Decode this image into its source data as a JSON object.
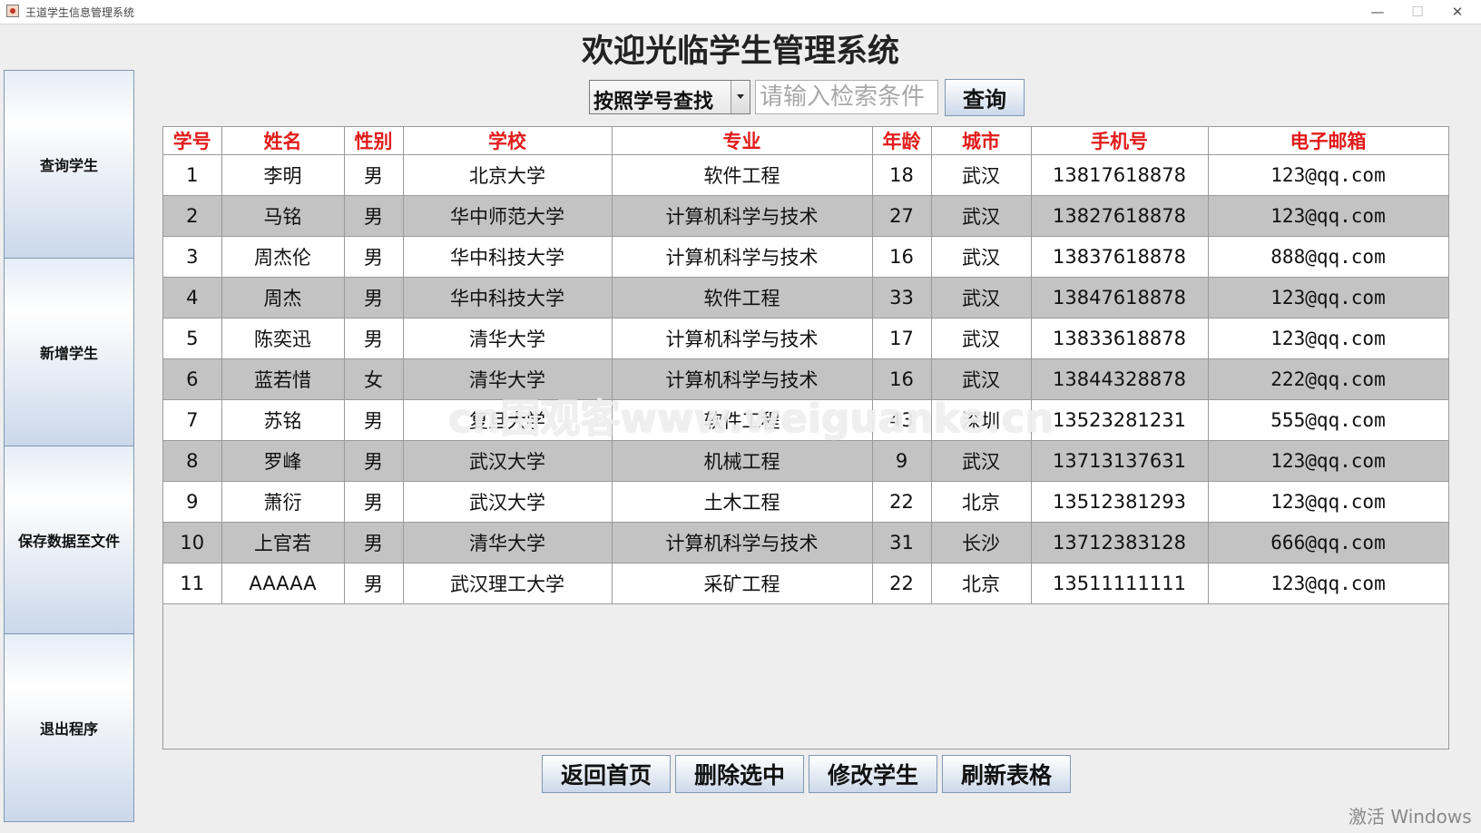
{
  "window": {
    "title": "王道学生信息管理系统",
    "minimize": "—",
    "maximize": "☐",
    "close": "✕"
  },
  "sidebar": {
    "items": [
      {
        "label": "查询学生"
      },
      {
        "label": "新增学生"
      },
      {
        "label": "保存数据至文件"
      },
      {
        "label": "退出程序"
      }
    ]
  },
  "main": {
    "title": "欢迎光临学生管理系统"
  },
  "search": {
    "mode": "按照学号查找",
    "placeholder": "请输入检索条件",
    "button": "查询"
  },
  "table": {
    "headers": [
      "学号",
      "姓名",
      "性别",
      "学校",
      "专业",
      "年龄",
      "城市",
      "手机号",
      "电子邮箱"
    ],
    "rows": [
      [
        "1",
        "李明",
        "男",
        "北京大学",
        "软件工程",
        "18",
        "武汉",
        "13817618878",
        "123@qq.com"
      ],
      [
        "2",
        "马铭",
        "男",
        "华中师范大学",
        "计算机科学与技术",
        "27",
        "武汉",
        "13827618878",
        "123@qq.com"
      ],
      [
        "3",
        "周杰伦",
        "男",
        "华中科技大学",
        "计算机科学与技术",
        "16",
        "武汉",
        "13837618878",
        "888@qq.com"
      ],
      [
        "4",
        "周杰",
        "男",
        "华中科技大学",
        "软件工程",
        "33",
        "武汉",
        "13847618878",
        "123@qq.com"
      ],
      [
        "5",
        "陈奕迅",
        "男",
        "清华大学",
        "计算机科学与技术",
        "17",
        "武汉",
        "13833618878",
        "123@qq.com"
      ],
      [
        "6",
        "蓝若惜",
        "女",
        "清华大学",
        "计算机科学与技术",
        "16",
        "武汉",
        "13844328878",
        "222@qq.com"
      ],
      [
        "7",
        "苏铭",
        "男",
        "复旦大学",
        "软件工程",
        "43",
        "深圳",
        "13523281231",
        "555@qq.com"
      ],
      [
        "8",
        "罗峰",
        "男",
        "武汉大学",
        "机械工程",
        "9",
        "武汉",
        "13713137631",
        "123@qq.com"
      ],
      [
        "9",
        "萧衍",
        "男",
        "武汉大学",
        "土木工程",
        "22",
        "北京",
        "13512381293",
        "123@qq.com"
      ],
      [
        "10",
        "上官若",
        "男",
        "清华大学",
        "计算机科学与技术",
        "31",
        "长沙",
        "13712383128",
        "666@qq.com"
      ],
      [
        "11",
        "AAAAA",
        "男",
        "武汉理工大学",
        "采矿工程",
        "22",
        "北京",
        "13511111111",
        "123@qq.com"
      ]
    ]
  },
  "actions": {
    "home": "返回首页",
    "delete": "删除选中",
    "edit": "修改学生",
    "refresh": "刷新表格"
  },
  "watermark": "cn围观客www.weiguanke.cn",
  "activation": "激活 Windows",
  "colors": {
    "header_text": "#e21b1b",
    "row_alt": "#c3c3c3",
    "button_border": "#7f98b4"
  }
}
